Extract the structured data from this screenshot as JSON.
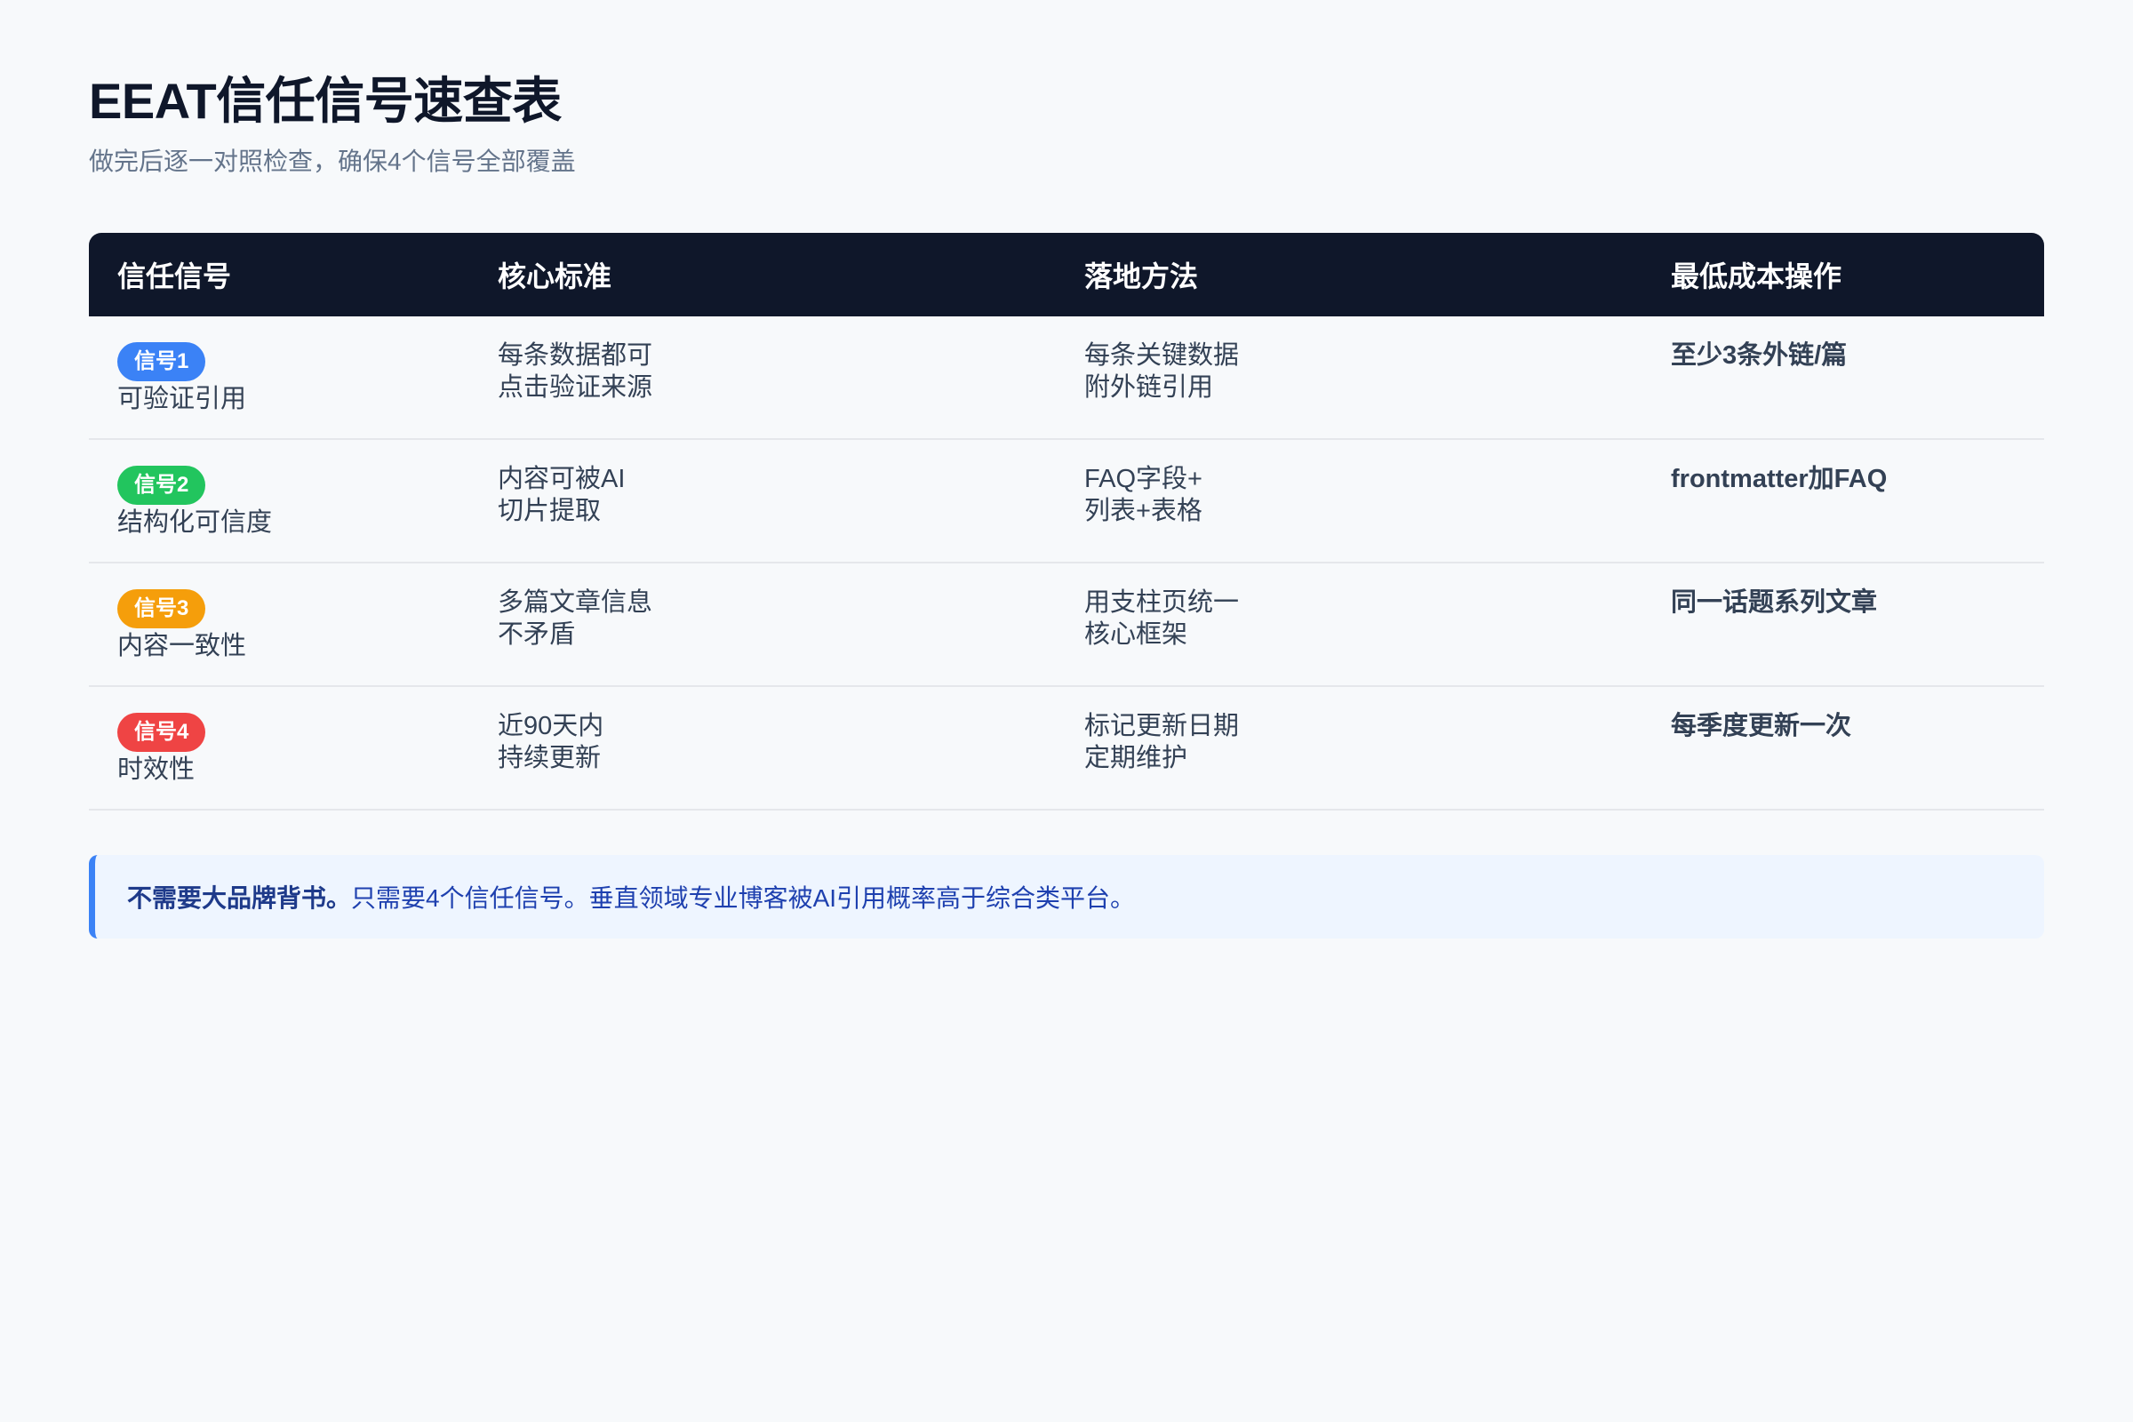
{
  "page": {
    "title": "EEAT信任信号速查表",
    "subtitle": "做完后逐一对照检查，确保4个信号全部覆盖"
  },
  "table": {
    "headers": [
      "信任信号",
      "核心标准",
      "落地方法",
      "最低成本操作"
    ],
    "rows": [
      {
        "badge": "信号1",
        "badge_color": "#3b82f6",
        "signal": "可验证引用",
        "standard": [
          "每条数据都可",
          "点击验证来源"
        ],
        "method": [
          "每条关键数据",
          "附外链引用"
        ],
        "action": "至少3条外链/篇"
      },
      {
        "badge": "信号2",
        "badge_color": "#22c55e",
        "signal": "结构化可信度",
        "standard": [
          "内容可被AI",
          "切片提取"
        ],
        "method": [
          "FAQ字段+",
          "列表+表格"
        ],
        "action": "frontmatter加FAQ"
      },
      {
        "badge": "信号3",
        "badge_color": "#f59e0b",
        "signal": "内容一致性",
        "standard": [
          "多篇文章信息",
          "不矛盾"
        ],
        "method": [
          "用支柱页统一",
          "核心框架"
        ],
        "action": "同一话题系列文章"
      },
      {
        "badge": "信号4",
        "badge_color": "#ef4444",
        "signal": "时效性",
        "standard": [
          "近90天内",
          "持续更新"
        ],
        "method": [
          "标记更新日期",
          "定期维护"
        ],
        "action": "每季度更新一次"
      }
    ]
  },
  "note": {
    "strong": "不需要大品牌背书。",
    "text": "只需要4个信任信号。垂直领域专业博客被AI引用概率高于综合类平台。",
    "accent_color": "#3b82f6"
  }
}
